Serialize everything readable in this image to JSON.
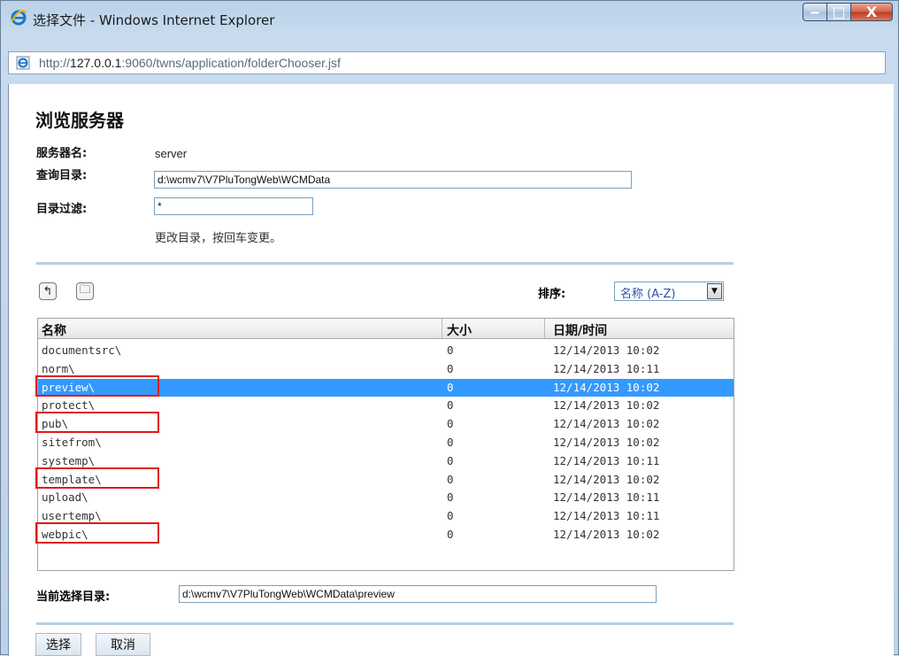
{
  "window": {
    "title": "选择文件 - Windows Internet Explorer",
    "address_prefix": "http://",
    "address_host": "127.0.0.1",
    "address_rest": ":9060/twns/application/folderChooser.jsf",
    "controls": {
      "minimize": "‒",
      "maximize": "□",
      "close": "X"
    }
  },
  "page": {
    "heading": "浏览服务器",
    "server_label": "服务器名:",
    "server_value": "server",
    "query_label": "查询目录:",
    "query_value": "d:\\wcmv7\\V7PluTongWeb\\WCMData",
    "filter_label": "目录过滤:",
    "filter_value": "*",
    "hint": "更改目录，按回车变更。"
  },
  "toolbar": {
    "up_icon": "↰",
    "folder_icon": "🗀",
    "sort_label": "排序:",
    "sort_value": "名称 (A-Z)",
    "sort_arrow": "▼"
  },
  "table": {
    "columns": [
      "名称",
      "大小",
      "日期/时间"
    ],
    "rows": [
      {
        "name": "documentsrc\\",
        "size": "0",
        "date": "12/14/2013 10:02"
      },
      {
        "name": "norm\\",
        "size": "0",
        "date": "12/14/2013 10:11"
      },
      {
        "name": "preview\\",
        "size": "0",
        "date": "12/14/2013 10:02"
      },
      {
        "name": "protect\\",
        "size": "0",
        "date": "12/14/2013 10:02"
      },
      {
        "name": "pub\\",
        "size": "0",
        "date": "12/14/2013 10:02"
      },
      {
        "name": "sitefrom\\",
        "size": "0",
        "date": "12/14/2013 10:02"
      },
      {
        "name": "systemp\\",
        "size": "0",
        "date": "12/14/2013 10:11"
      },
      {
        "name": "template\\",
        "size": "0",
        "date": "12/14/2013 10:02"
      },
      {
        "name": "upload\\",
        "size": "0",
        "date": "12/14/2013 10:11"
      },
      {
        "name": "usertemp\\",
        "size": "0",
        "date": "12/14/2013 10:11"
      },
      {
        "name": "webpic\\",
        "size": "0",
        "date": "12/14/2013 10:02"
      }
    ]
  },
  "current": {
    "label": "当前选择目录:",
    "value": "d:\\wcmv7\\V7PluTongWeb\\WCMData\\preview"
  },
  "buttons": {
    "select": "选择",
    "cancel": "取消"
  },
  "colors": {
    "selection": "#3399ff",
    "highlight_box": "#e0191b",
    "separator": "#b5cde3"
  }
}
